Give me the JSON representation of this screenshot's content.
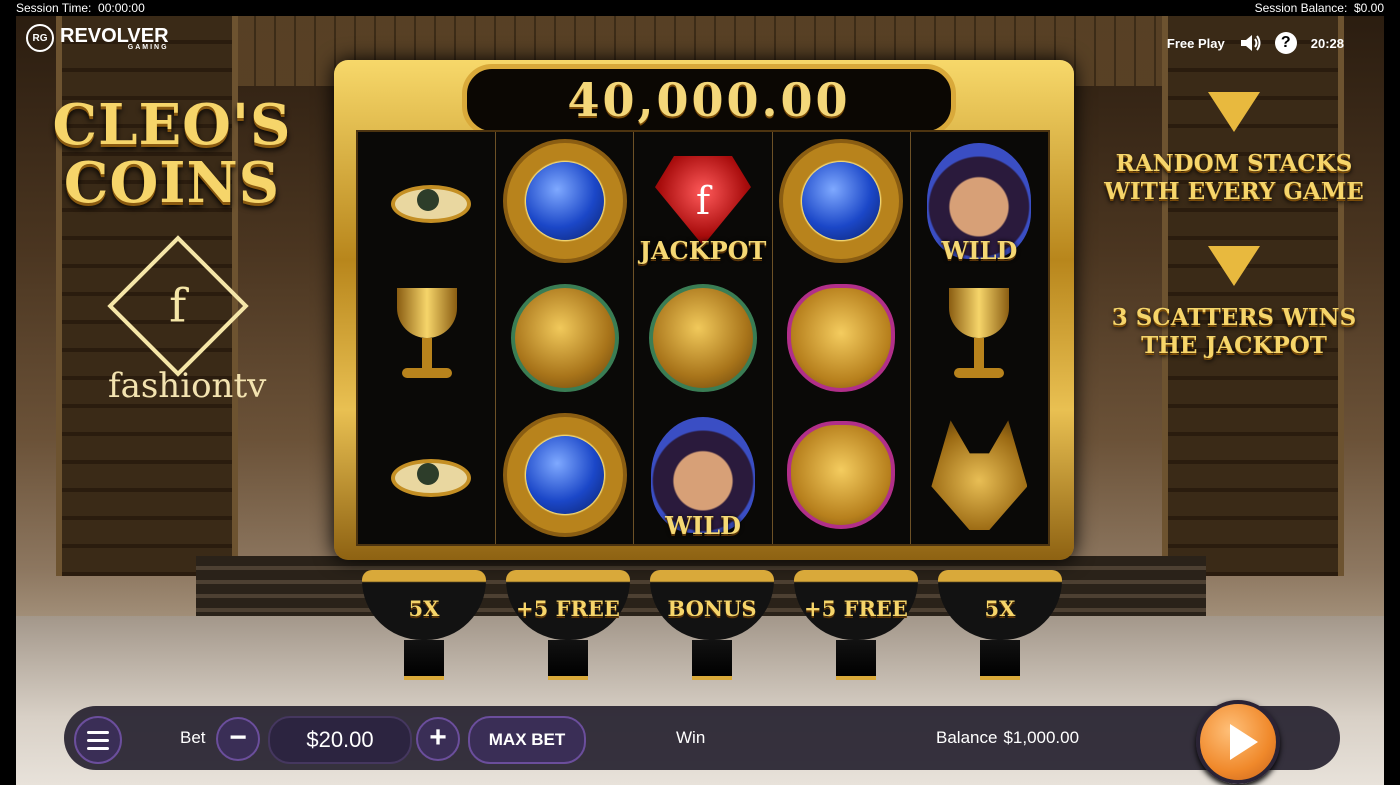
{
  "session": {
    "time_label": "Session Time:",
    "time_value": "00:00:00",
    "balance_label": "Session Balance:",
    "balance_value": "$0.00"
  },
  "brand": {
    "name": "REVOLVER",
    "sub": "GAMING",
    "mark": "RG"
  },
  "game": {
    "title_line1": "CLEO'S",
    "title_line2": "COINS",
    "partner_mark": "f",
    "partner_word": "fashiontv"
  },
  "header": {
    "mode": "Free Play",
    "clock": "20:28",
    "help": "?"
  },
  "jackpot": {
    "amount": "40,000.00"
  },
  "features": {
    "line1": "RANDOM STACKS WITH EVERY GAME",
    "line2": "3 SCATTERS WINS THE JACKPOT"
  },
  "reels": [
    [
      "eye",
      "cup",
      "eye"
    ],
    [
      "sapphire-coin",
      "falcon",
      "sapphire-coin"
    ],
    [
      "jackpot-gem",
      "falcon",
      "queen-wild"
    ],
    [
      "sapphire-coin",
      "cat",
      "cat"
    ],
    [
      "queen-wild",
      "cup",
      "jackal"
    ]
  ],
  "labels": {
    "jackpot": "JACKPOT",
    "wild": "WILD",
    "wild2": "WILD"
  },
  "bowls": [
    "5X",
    "+5 FREE",
    "BONUS",
    "+5 FREE",
    "5X"
  ],
  "controls": {
    "bet_label": "Bet",
    "bet_value": "$20.00",
    "minus": "−",
    "plus": "+",
    "max_bet": "MAX BET",
    "win_label": "Win",
    "balance_label": "Balance",
    "balance_value": "$1,000.00"
  },
  "colors": {
    "gold": "#f6d56a",
    "accent": "#f0892b",
    "panel": "#262230"
  }
}
